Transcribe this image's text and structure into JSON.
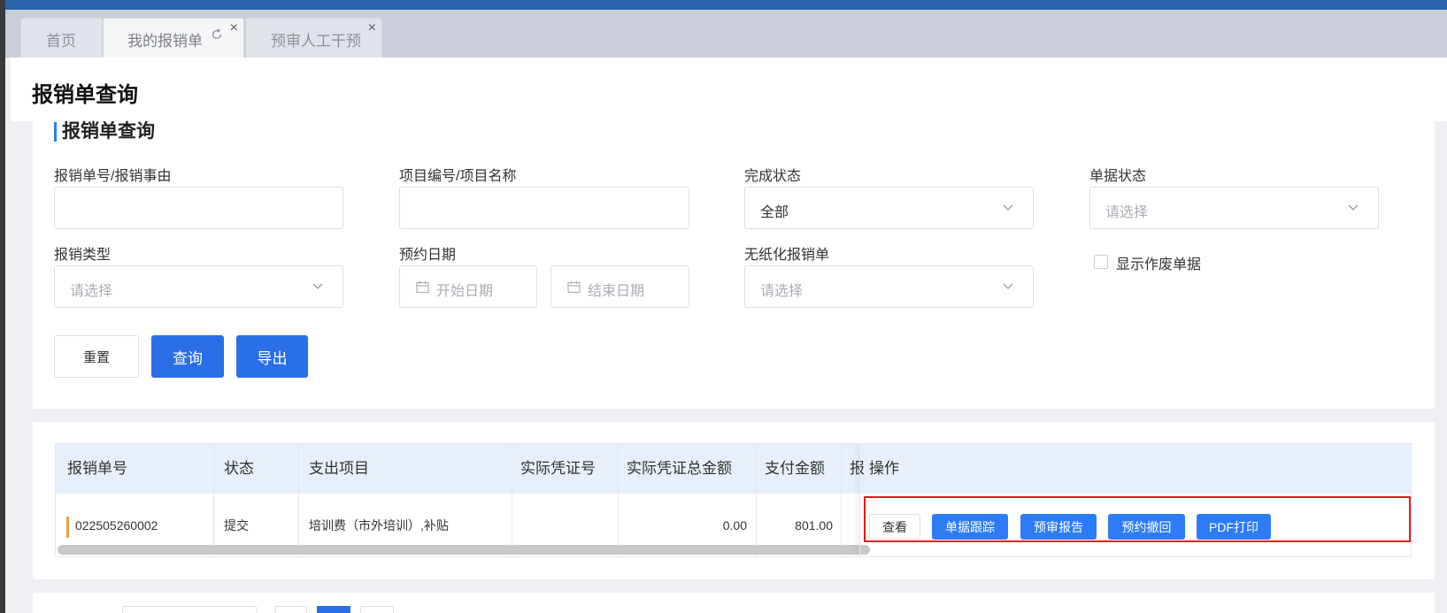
{
  "tabs": [
    {
      "label": "首页",
      "active": false,
      "closable": false
    },
    {
      "label": "我的报销单",
      "active": true,
      "closable": true,
      "has_refresh": true
    },
    {
      "label": "预审人工干预",
      "active": false,
      "closable": true
    }
  ],
  "close_glyph": "×",
  "page_title": "报销单查询",
  "filter": {
    "section_title": "报销单查询",
    "fields": {
      "report_no_label": "报销单号/报销事由",
      "report_no_value": "",
      "project_label": "项目编号/项目名称",
      "project_value": "",
      "complete_status_label": "完成状态",
      "complete_status_value": "全部",
      "doc_status_label": "单据状态",
      "doc_status_placeholder": "请选择",
      "type_label": "报销类型",
      "type_placeholder": "请选择",
      "date_label": "预约日期",
      "start_date_placeholder": "开始日期",
      "end_date_placeholder": "结束日期",
      "paperless_label": "无纸化报销单",
      "paperless_placeholder": "请选择",
      "show_void_label": "显示作废单据",
      "show_void_checked": false
    },
    "buttons": {
      "reset": "重置",
      "query": "查询",
      "export": "导出"
    }
  },
  "table": {
    "columns": [
      "报销单号",
      "状态",
      "支出项目",
      "实际凭证号",
      "实际凭证总金额",
      "支付金额",
      "报",
      "操作"
    ],
    "rows": [
      {
        "report_no": "022505260002",
        "status": "提交",
        "expense_item": "培训费（市外培训）,补贴",
        "voucher_no": "",
        "voucher_total": "0.00",
        "pay_amount": "801.00",
        "actions": [
          "查看",
          "单据跟踪",
          "预审报告",
          "预约撤回",
          "PDF打印"
        ]
      }
    ]
  },
  "colors": {
    "primary": "#2a6ee8",
    "highlight_box": "#e8191a",
    "row_marker": "#e6a23c",
    "header_bg": "#e6effb"
  }
}
